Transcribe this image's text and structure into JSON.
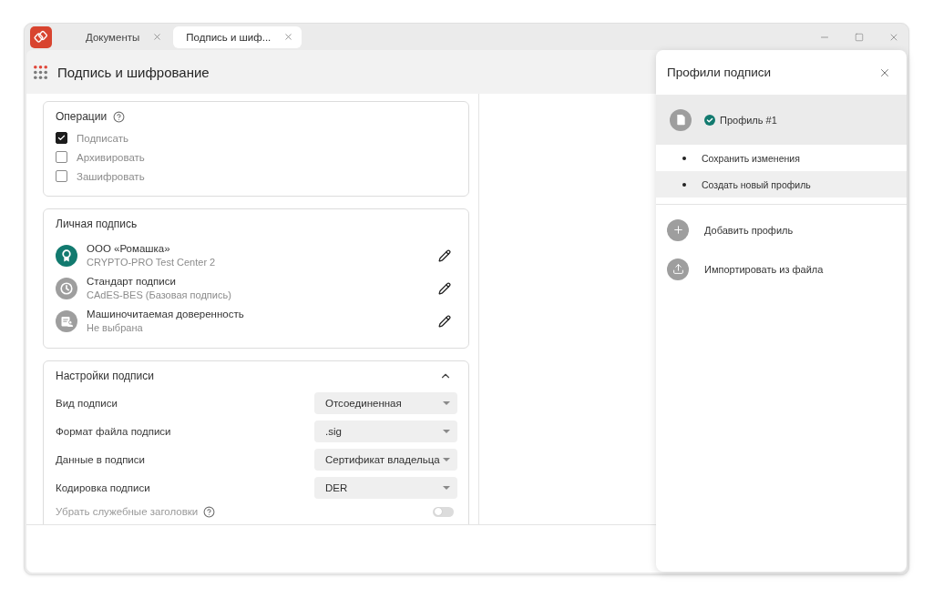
{
  "window": {
    "tabs": [
      {
        "label": "Документы",
        "selected": false
      },
      {
        "label": "Подпись и шиф...",
        "selected": true
      }
    ]
  },
  "header": {
    "title": "Подпись и шифрование"
  },
  "operations": {
    "title": "Операции",
    "items": [
      {
        "label": "Подписать",
        "checked": true
      },
      {
        "label": "Архивировать",
        "checked": false
      },
      {
        "label": "Зашифровать",
        "checked": false
      }
    ]
  },
  "personal_signature": {
    "title": "Личная подпись",
    "items": [
      {
        "kind": "certificate",
        "color": "#127a6f",
        "title": "ООО «Ромашка»",
        "subtitle": "CRYPTO-PRO Test Center 2"
      },
      {
        "kind": "standard",
        "color": "#9e9e9e",
        "title": "Стандарт подписи",
        "subtitle": "CAdES-BES (Базовая подпись)"
      },
      {
        "kind": "power_of_attorney",
        "color": "#9e9e9e",
        "title": "Машиночитаемая доверенность",
        "subtitle": "Не выбрана"
      }
    ]
  },
  "signature_settings": {
    "title": "Настройки подписи",
    "expanded": true,
    "fields": [
      {
        "kind": "select",
        "label": "Вид подписи",
        "value": "Отсоединенная",
        "disabled": false
      },
      {
        "kind": "select",
        "label": "Формат файла подписи",
        "value": ".sig",
        "disabled": false
      },
      {
        "kind": "select",
        "label": "Данные в подписи",
        "value": "Сертификат владельца",
        "disabled": false
      },
      {
        "kind": "select",
        "label": "Кодировка подписи",
        "value": "DER",
        "disabled": false
      },
      {
        "kind": "toggle",
        "label": "Убрать служебные заголовки",
        "on": false,
        "disabled": true
      }
    ]
  },
  "profiles_panel": {
    "title": "Профили подписи",
    "profiles": [
      {
        "name": "Профиль #1",
        "selected": true
      }
    ],
    "menu": [
      {
        "label": "Сохранить изменения",
        "highlighted": false
      },
      {
        "label": "Создать новый профиль",
        "highlighted": true
      }
    ],
    "actions": [
      {
        "kind": "add",
        "label": "Добавить профиль"
      },
      {
        "kind": "import",
        "label": "Импортировать из файла"
      }
    ]
  }
}
